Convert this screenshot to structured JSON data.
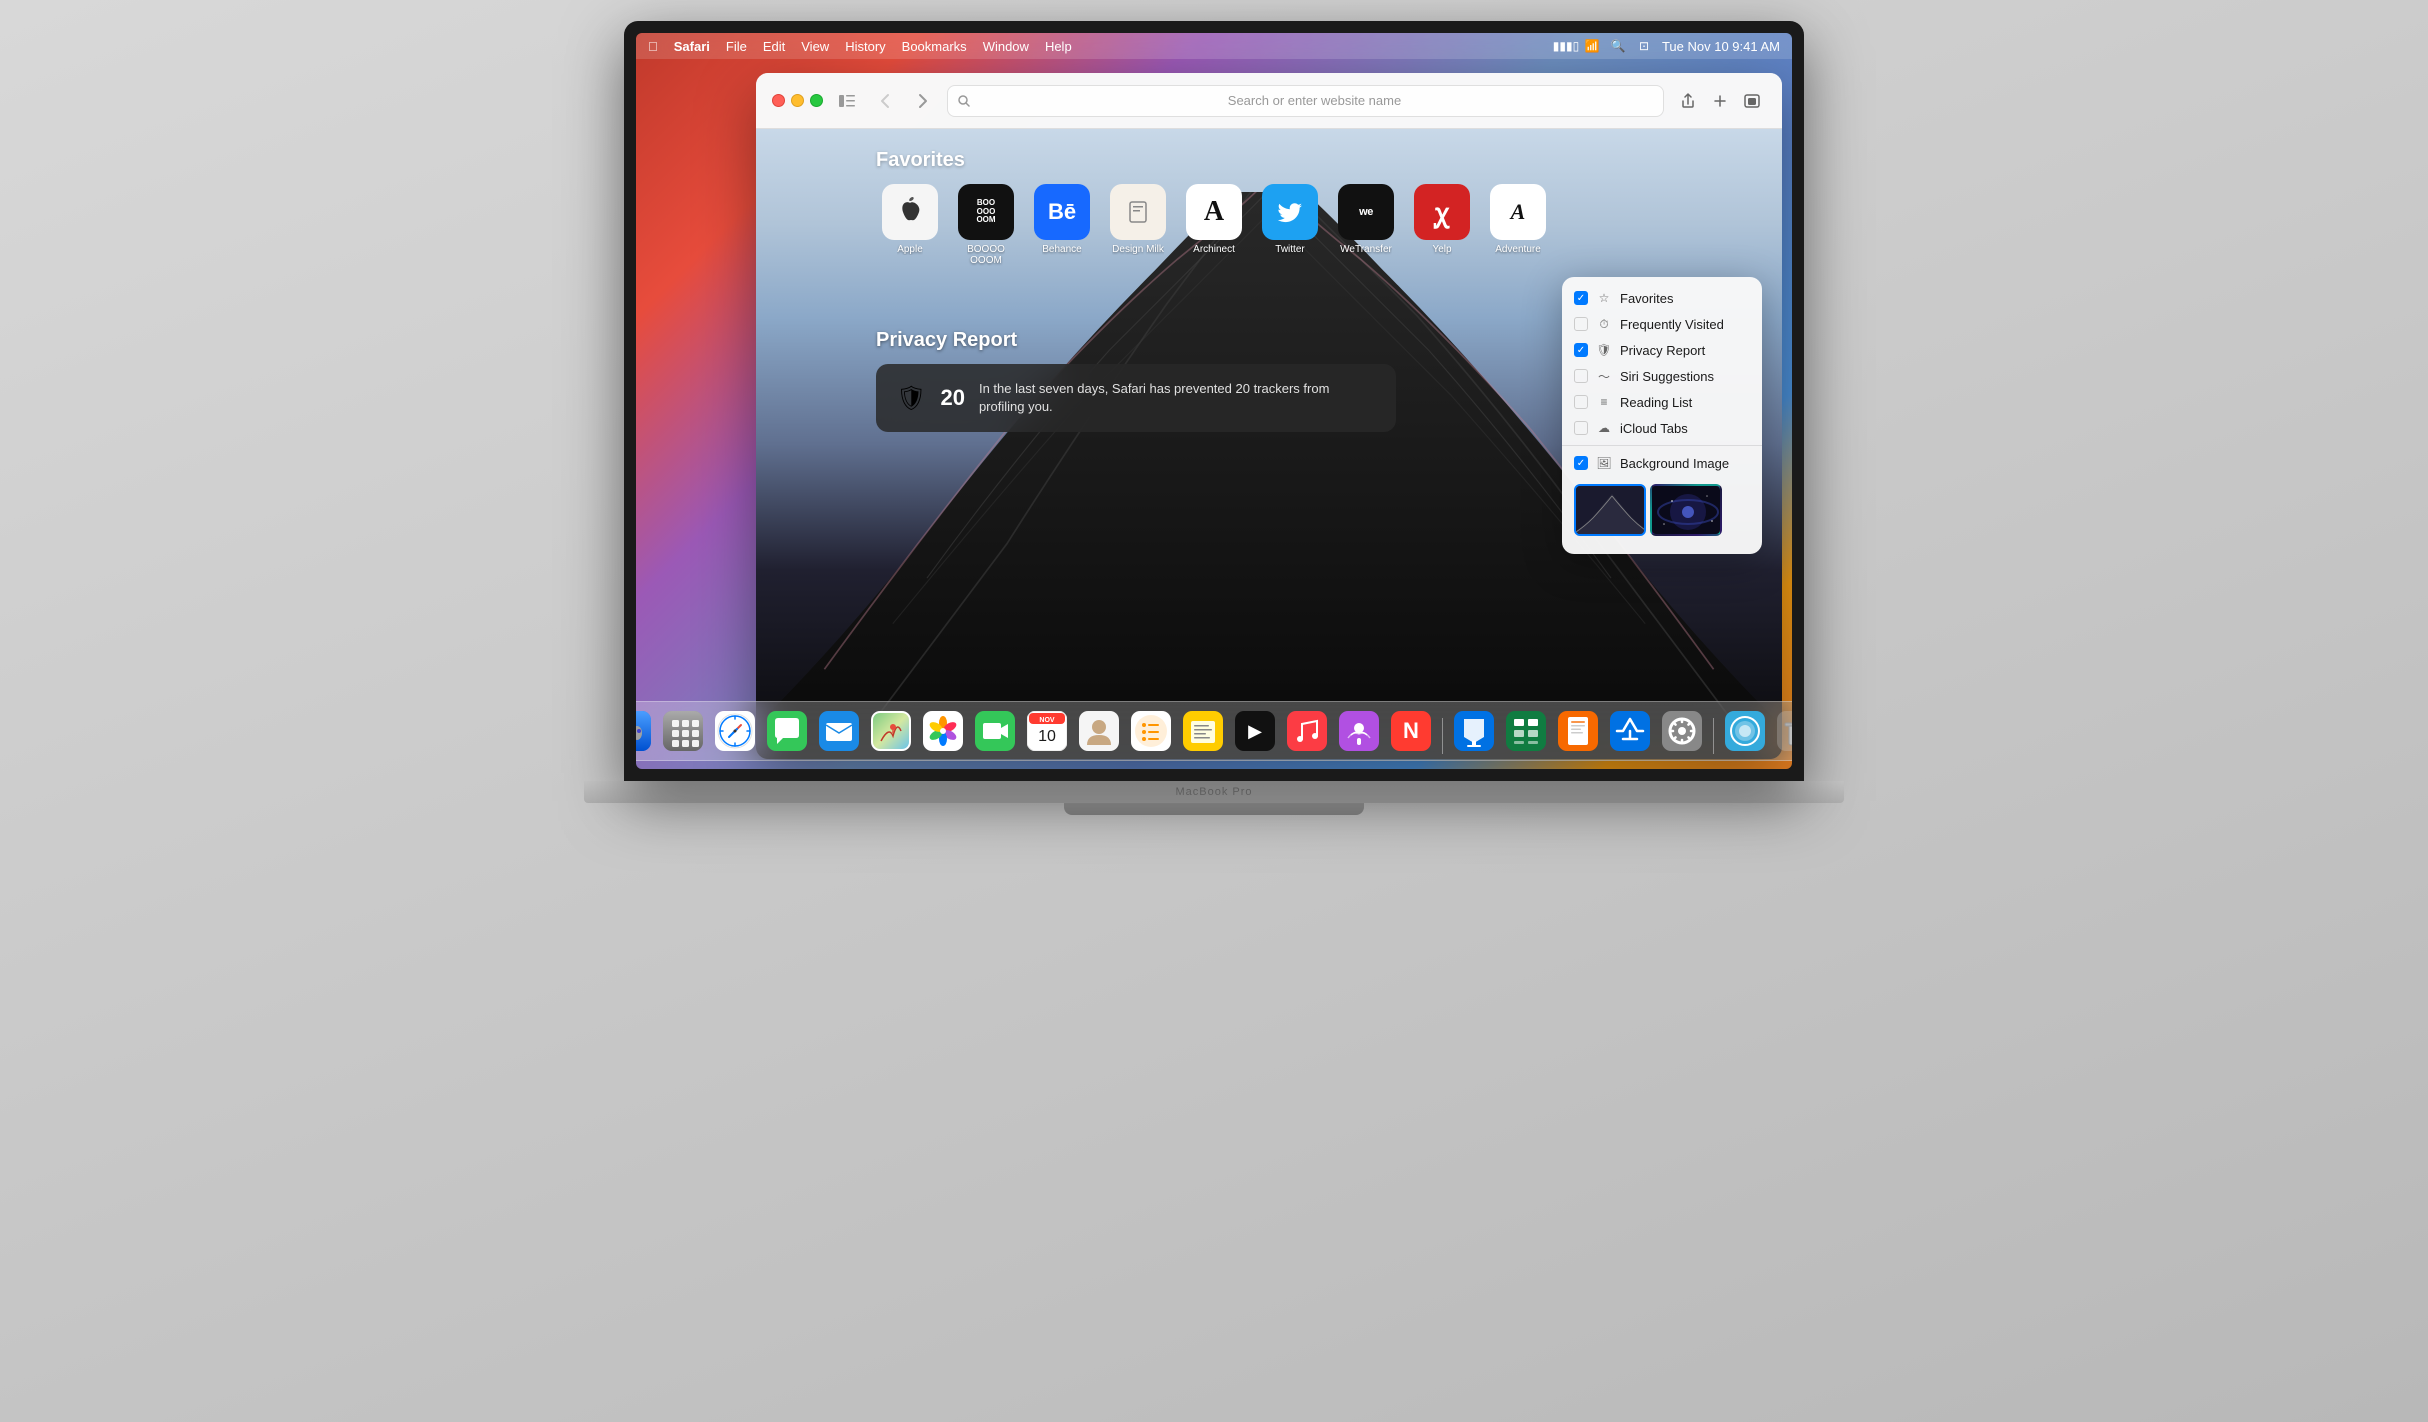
{
  "menubar": {
    "apple": "⌘",
    "app": "Safari",
    "items": [
      "File",
      "Edit",
      "View",
      "History",
      "Bookmarks",
      "Window",
      "Help"
    ],
    "time": "Tue Nov 10  9:41 AM"
  },
  "safari": {
    "address_placeholder": "Search or enter website name",
    "new_tab_btn": "+",
    "share_btn": "⬆",
    "tabs_btn": "⧉"
  },
  "startpage": {
    "favorites_title": "Favorites",
    "favorites": [
      {
        "name": "Apple",
        "label": "Apple",
        "icon": "🍎",
        "style": "fi-apple"
      },
      {
        "name": "BOOOOM",
        "label": "BOOOO\nOOOM",
        "icon": "BOO\nOOO\nOOM",
        "style": "fi-boooom"
      },
      {
        "name": "Behance",
        "label": "Behance",
        "icon": "Bē",
        "style": "fi-behance"
      },
      {
        "name": "Design Milk",
        "label": "Design Milk",
        "icon": "🏺",
        "style": "fi-designmilk"
      },
      {
        "name": "Archinect",
        "label": "Archinect",
        "icon": "A",
        "style": "fi-architect"
      },
      {
        "name": "Twitter",
        "label": "Twitter",
        "icon": "🐦",
        "style": "fi-twitter"
      },
      {
        "name": "WeTransfer",
        "label": "WeTransfer",
        "icon": "we",
        "style": "fi-wetransfer"
      },
      {
        "name": "Yelp",
        "label": "Yelp",
        "icon": "ꭕ",
        "style": "fi-yelp"
      },
      {
        "name": "Adventure",
        "label": "Adventure",
        "icon": "A",
        "style": "fi-adventure"
      }
    ],
    "privacy_title": "Privacy Report",
    "privacy_count": "20",
    "privacy_text": "In the last seven days, Safari has prevented 20 trackers from profiling you."
  },
  "dropdown": {
    "items": [
      {
        "label": "Favorites",
        "checked": true,
        "icon": "☆"
      },
      {
        "label": "Frequently Visited",
        "checked": false,
        "icon": "⏱"
      },
      {
        "label": "Privacy Report",
        "checked": true,
        "icon": "🛡"
      },
      {
        "label": "Siri Suggestions",
        "checked": false,
        "icon": "∿"
      },
      {
        "label": "Reading List",
        "checked": false,
        "icon": "≡"
      },
      {
        "label": "iCloud Tabs",
        "checked": false,
        "icon": "☁"
      },
      {
        "label": "Background Image",
        "checked": true,
        "icon": "🖼"
      }
    ]
  },
  "dock": {
    "items": [
      {
        "name": "Finder",
        "emoji": "🔵",
        "color": "#0072ff"
      },
      {
        "name": "Launchpad",
        "emoji": "⊞",
        "color": "#888"
      },
      {
        "name": "Safari",
        "emoji": "🧭",
        "color": "#006ee6"
      },
      {
        "name": "Messages",
        "emoji": "💬",
        "color": "#34c759"
      },
      {
        "name": "Mail",
        "emoji": "✉",
        "color": "#1a8ae6"
      },
      {
        "name": "Maps",
        "emoji": "🗺",
        "color": "#34aadc"
      },
      {
        "name": "Photos",
        "emoji": "🌸",
        "color": "#ff2d55"
      },
      {
        "name": "FaceTime",
        "emoji": "📹",
        "color": "#34c759"
      },
      {
        "name": "Calendar",
        "emoji": "📅",
        "color": "#ff3b30"
      },
      {
        "name": "Contacts",
        "emoji": "👤",
        "color": "#888"
      },
      {
        "name": "Reminders",
        "emoji": "📋",
        "color": "#ff9500"
      },
      {
        "name": "Notes",
        "emoji": "📝",
        "color": "#ffcc00"
      },
      {
        "name": "Apple TV",
        "emoji": "📺",
        "color": "#000"
      },
      {
        "name": "Music",
        "emoji": "🎵",
        "color": "#fc3c44"
      },
      {
        "name": "Podcasts",
        "emoji": "🎙",
        "color": "#b150e2"
      },
      {
        "name": "News",
        "emoji": "📰",
        "color": "#ff3b30"
      },
      {
        "name": "Keynote",
        "emoji": "📊",
        "color": "#0071e3"
      },
      {
        "name": "Numbers",
        "emoji": "📈",
        "color": "#107c41"
      },
      {
        "name": "Pages",
        "emoji": "📄",
        "color": "#f76900"
      },
      {
        "name": "App Store",
        "emoji": "🅰",
        "color": "#0071e3"
      },
      {
        "name": "System Preferences",
        "emoji": "⚙",
        "color": "#888"
      },
      {
        "name": "Control Center",
        "emoji": "🔵",
        "color": "#34aadc"
      },
      {
        "name": "Trash",
        "emoji": "🗑",
        "color": "#888"
      }
    ]
  },
  "macbook_label": "MacBook Pro"
}
